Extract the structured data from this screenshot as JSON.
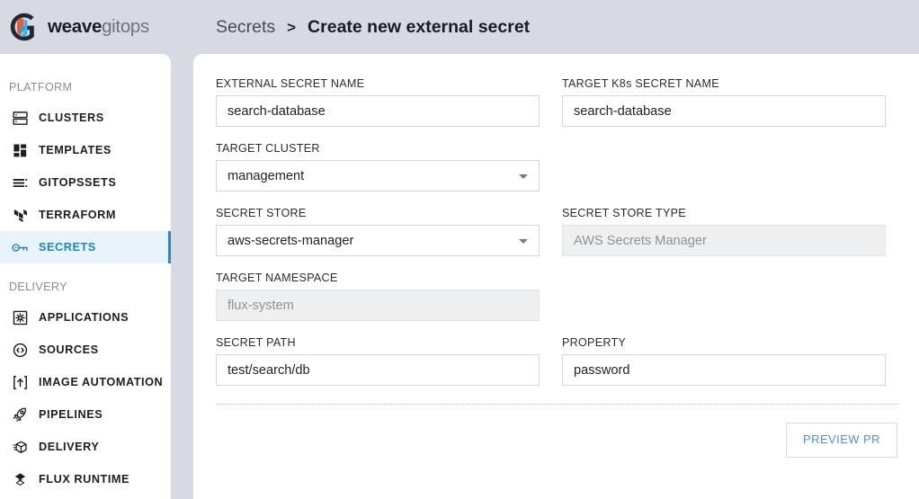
{
  "brand": {
    "name_bold": "weave",
    "name_light": "gitops",
    "logo_icon": "weave-gitops-logo",
    "colors": {
      "orange": "#f05a28",
      "cyan": "#37b9f0",
      "dark": "#26263a"
    }
  },
  "breadcrumb": {
    "root": "Secrets",
    "separator": ">",
    "current": "Create new external secret"
  },
  "sidebar": {
    "sections": [
      {
        "title": "PLATFORM",
        "items": [
          {
            "label": "CLUSTERS",
            "icon": "clusters-icon",
            "active": false
          },
          {
            "label": "TEMPLATES",
            "icon": "templates-icon",
            "active": false
          },
          {
            "label": "GITOPSSETS",
            "icon": "gitopssets-icon",
            "active": false
          },
          {
            "label": "TERRAFORM",
            "icon": "terraform-icon",
            "active": false
          },
          {
            "label": "SECRETS",
            "icon": "secrets-key-icon",
            "active": true
          }
        ]
      },
      {
        "title": "DELIVERY",
        "items": [
          {
            "label": "APPLICATIONS",
            "icon": "applications-icon",
            "active": false
          },
          {
            "label": "SOURCES",
            "icon": "sources-icon",
            "active": false
          },
          {
            "label": "IMAGE AUTOMATION",
            "icon": "image-automation-icon",
            "active": false
          },
          {
            "label": "PIPELINES",
            "icon": "pipelines-rocket-icon",
            "active": false
          },
          {
            "label": "DELIVERY",
            "icon": "delivery-box-icon",
            "active": false
          },
          {
            "label": "FLUX RUNTIME",
            "icon": "flux-runtime-icon",
            "active": false
          }
        ]
      }
    ],
    "active_accent_color": "#2f86c5"
  },
  "form": {
    "fields": {
      "external_secret_name": {
        "label": "EXTERNAL SECRET NAME",
        "value": "search-database",
        "disabled": false
      },
      "target_k8s_secret_name": {
        "label": "TARGET K8s SECRET NAME",
        "value": "search-database",
        "disabled": false
      },
      "target_cluster": {
        "label": "TARGET CLUSTER",
        "value": "management",
        "disabled": false,
        "type": "select"
      },
      "secret_store": {
        "label": "SECRET STORE",
        "value": "aws-secrets-manager",
        "disabled": false,
        "type": "select"
      },
      "secret_store_type": {
        "label": "SECRET STORE TYPE",
        "value": "AWS Secrets Manager",
        "disabled": true
      },
      "target_namespace": {
        "label": "TARGET NAMESPACE",
        "value": "flux-system",
        "disabled": true
      },
      "secret_path": {
        "label": "SECRET PATH",
        "value": "test/search/db",
        "disabled": false
      },
      "property": {
        "label": "PROPERTY",
        "value": "password",
        "disabled": false
      }
    },
    "actions": {
      "preview_pr_label": "PREVIEW PR",
      "preview_pr_color": "#4a95cc"
    }
  }
}
